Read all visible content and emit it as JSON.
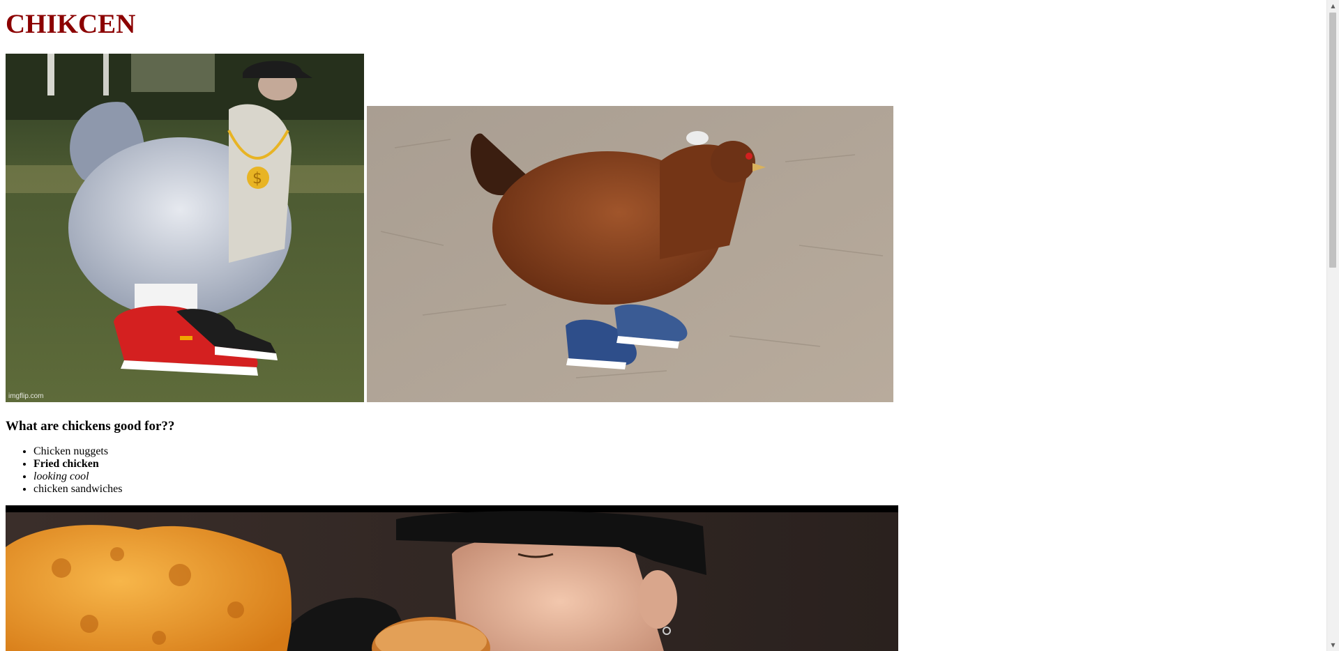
{
  "page": {
    "title": "CHIKCEN",
    "title_color": "#8b0000"
  },
  "images": [
    {
      "description_icon": "chicken-with-sneakers-and-chain-image",
      "watermark": "imgflip.com"
    },
    {
      "description_icon": "brown-hen-with-sneakers-image"
    },
    {
      "description_icon": "fried-chicken-eating-image"
    }
  ],
  "section": {
    "heading": "What are chickens good for??",
    "items": [
      {
        "label": "Chicken nuggets",
        "style": "normal"
      },
      {
        "label": "Fried chicken",
        "style": "bold"
      },
      {
        "label": "looking cool",
        "style": "italic"
      },
      {
        "label": "chicken sandwiches",
        "style": "normal"
      }
    ]
  },
  "scrollbar": {
    "position_fraction": 0.0,
    "visible_fraction": 0.39
  }
}
